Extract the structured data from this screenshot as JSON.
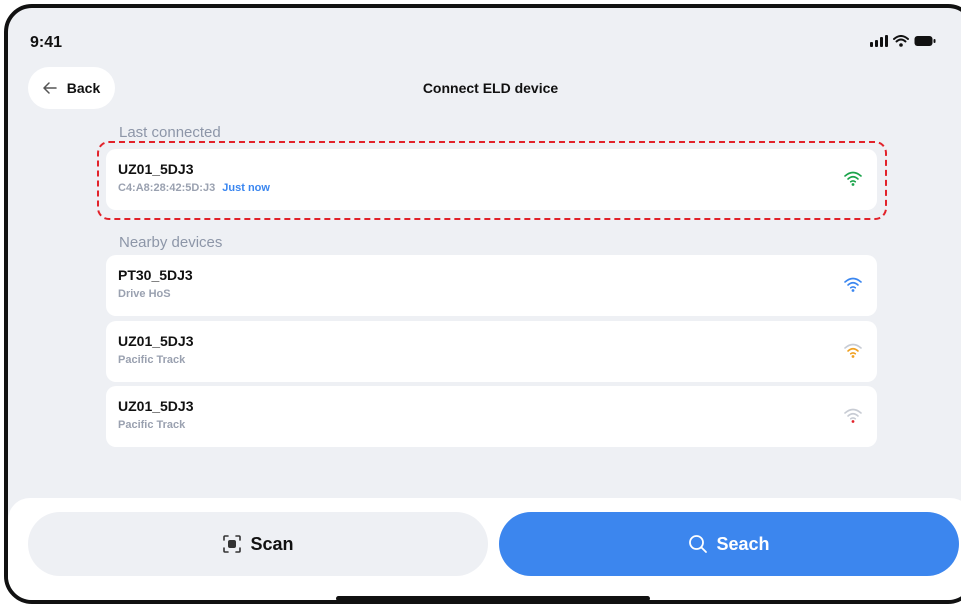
{
  "status_bar": {
    "time": "9:41"
  },
  "header": {
    "back_label": "Back",
    "title": "Connect ELD device"
  },
  "sections": {
    "last_connected": "Last connected",
    "nearby": "Nearby devices"
  },
  "last_connected_device": {
    "name": "UZ01_5DJ3",
    "mac": "C4:A8:28:42:5D:J3",
    "time": "Just now",
    "signal_color": "#1aa34a"
  },
  "nearby_devices": [
    {
      "name": "PT30_5DJ3",
      "sub": "Drive HoS",
      "signal_color": "#3a86f0",
      "signal_bars": 3
    },
    {
      "name": "UZ01_5DJ3",
      "sub": "Pacific Track",
      "signal_color": "#f0a020",
      "signal_bars": 2
    },
    {
      "name": "UZ01_5DJ3",
      "sub": "Pacific Track",
      "signal_color": "#e2222a",
      "signal_bars": 1
    }
  ],
  "actions": {
    "scan_label": "Scan",
    "search_label": "Seach"
  },
  "colors": {
    "accent": "#3c86ee",
    "highlight": "#e2222a"
  }
}
